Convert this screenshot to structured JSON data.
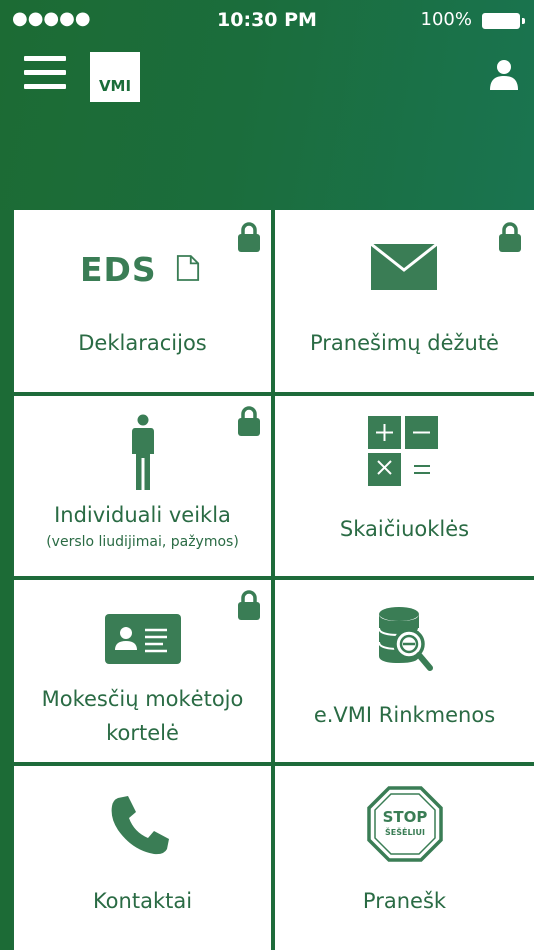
{
  "status_bar": {
    "signal": "●●●●●",
    "time": "10:30 PM",
    "battery": "100%"
  },
  "header": {
    "logo_text": "VMI",
    "menu_icon": "hamburger-menu-icon",
    "profile_icon": "user-icon"
  },
  "tiles": [
    {
      "label": "Deklaracijos",
      "icon": "eds-logo-icon",
      "icon_text": "EDS",
      "locked": true
    },
    {
      "label": "Pranešimų dėžutė",
      "icon": "envelope-icon",
      "locked": true
    },
    {
      "label": "Individuali veikla",
      "sub": "(verslo liudijimai, pažymos)",
      "icon": "person-icon",
      "locked": true
    },
    {
      "label": "Skaičiuoklės",
      "icon": "calculator-icon",
      "locked": false
    },
    {
      "label_line1": "Mokesčių mokėtojo",
      "label_line2": "kortelė",
      "icon": "id-card-icon",
      "locked": true
    },
    {
      "label": "e.VMI Rinkmenos",
      "icon": "database-search-icon",
      "locked": false
    },
    {
      "label": "Kontaktai",
      "icon": "phone-icon",
      "locked": false
    },
    {
      "label": "Pranešk",
      "icon": "stop-sign-icon",
      "stop_line1": "STOP",
      "stop_line2": "ŠEŠĖLIUI",
      "locked": false
    }
  ],
  "colors": {
    "brand_green": "#1c6b36",
    "icon_green": "#3a7d55",
    "text_green": "#2a6b44"
  }
}
